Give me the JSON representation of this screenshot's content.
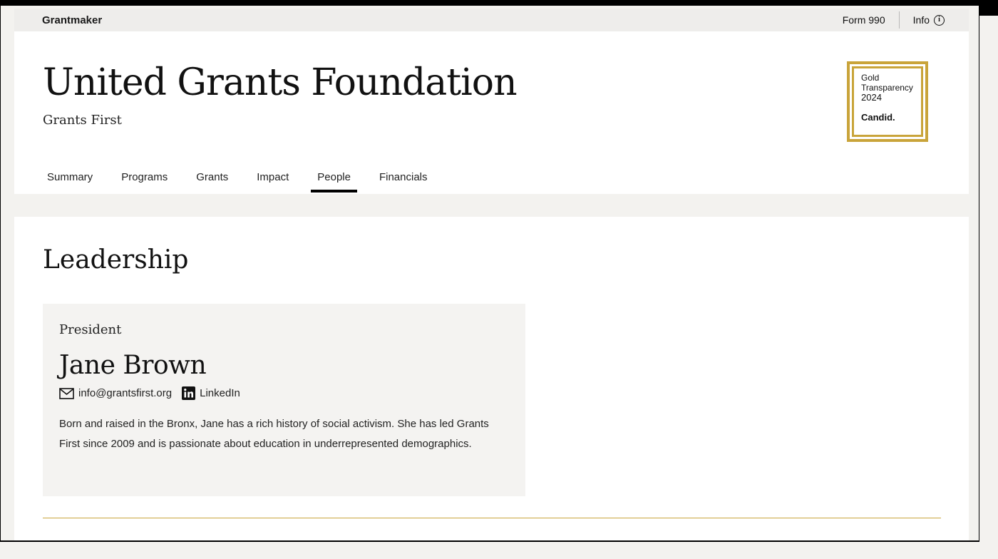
{
  "topbar": {
    "brand": "Grantmaker",
    "form990_label": "Form 990",
    "info_label": "Info"
  },
  "org": {
    "name": "United Grants Foundation",
    "subtitle": "Grants First"
  },
  "seal": {
    "line1": "Gold",
    "line2": "Transparency",
    "year": "2024",
    "brand": "Candid."
  },
  "tabs": [
    {
      "label": "Summary",
      "active": false
    },
    {
      "label": "Programs",
      "active": false
    },
    {
      "label": "Grants",
      "active": false
    },
    {
      "label": "Impact",
      "active": false
    },
    {
      "label": "People",
      "active": true
    },
    {
      "label": "Financials",
      "active": false
    }
  ],
  "section": {
    "title": "Leadership"
  },
  "leader": {
    "role": "President",
    "name": "Jane Brown",
    "email": "info@grantsfirst.org",
    "linkedin_label": "LinkedIn",
    "bio": "Born and raised in the Bronx, Jane has a rich history of social activism. She has led Grants First since 2009 and is passionate about education in underrepresented demographics."
  },
  "icons": {
    "info": "info-circle-icon",
    "email": "mail-icon",
    "linkedin": "linkedin-icon"
  },
  "colors": {
    "accent_gold": "#c9a43a",
    "active_tab_underline": "#000000",
    "card_background": "#f4f3f1",
    "page_background": "#f3f2ef"
  }
}
